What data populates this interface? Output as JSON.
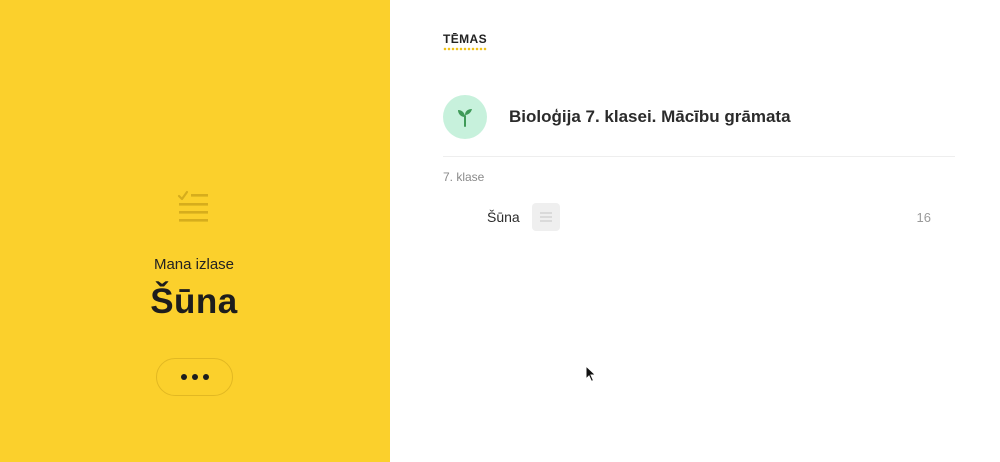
{
  "sidebar": {
    "caption": "Mana izlase",
    "title": "Šūna",
    "more_icon": "more-horizontal-icon",
    "list_icon": "checklist-icon"
  },
  "main": {
    "tab_label": "TĒMAS",
    "book": {
      "title": "Bioloģija 7. klasei. Mācību grāmata",
      "icon": "sprout-icon"
    },
    "grade_label": "7. klase",
    "topics": [
      {
        "name": "Šūna",
        "icon": "document-icon",
        "page": "16"
      }
    ]
  },
  "colors": {
    "sidebar_bg": "#fbd02c",
    "accent_underline": "#f0c21b",
    "book_avatar_bg": "#c7f1dc",
    "sprout": "#3f9a58"
  }
}
